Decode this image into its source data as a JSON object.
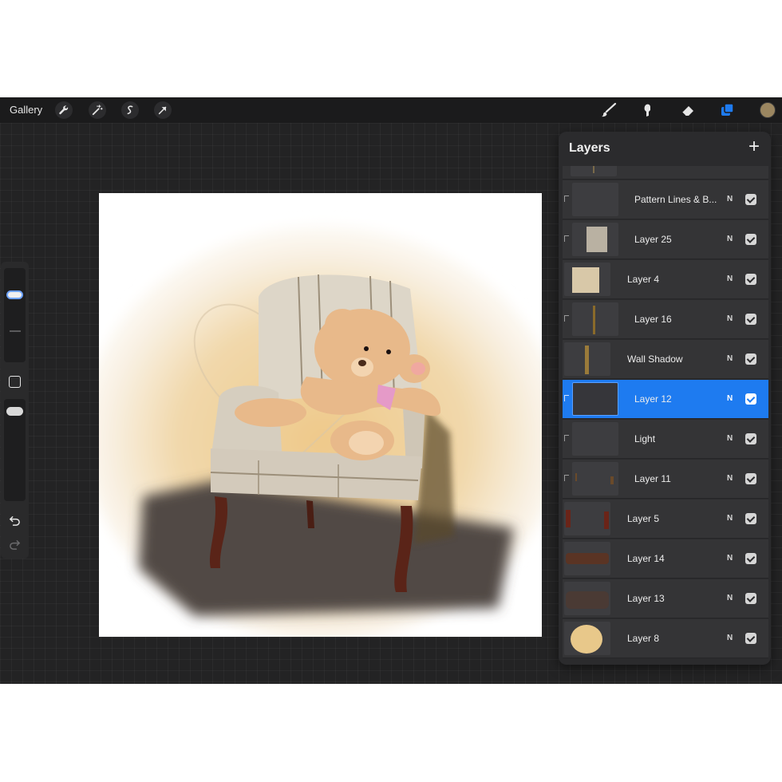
{
  "topbar": {
    "gallery_label": "Gallery",
    "left_tools": [
      {
        "name": "actions-wrench-icon"
      },
      {
        "name": "adjustments-wand-icon"
      },
      {
        "name": "selection-icon"
      },
      {
        "name": "transform-arrow-icon"
      }
    ],
    "right_tools": [
      {
        "name": "brush-icon"
      },
      {
        "name": "smudge-icon"
      },
      {
        "name": "eraser-icon"
      },
      {
        "name": "layers-icon",
        "active_color": "#1e7bf0"
      }
    ],
    "current_color": "#9b8660"
  },
  "sidebar": {
    "brush_size_slider": {
      "level": 0.75
    },
    "opacity_slider": {
      "level": 0.25
    },
    "accent": "#6ea3ff"
  },
  "layers_panel": {
    "title": "Layers",
    "add_label": "+",
    "layers": [
      {
        "name": "",
        "blend": "",
        "visible": true,
        "clipped": false,
        "selected": false
      },
      {
        "name": "Pattern Lines & B...",
        "blend": "N",
        "visible": true,
        "clipped": true,
        "selected": false
      },
      {
        "name": "Layer 25",
        "blend": "N",
        "visible": true,
        "clipped": true,
        "selected": false
      },
      {
        "name": "Layer 4",
        "blend": "N",
        "visible": true,
        "clipped": false,
        "selected": false
      },
      {
        "name": "Layer 16",
        "blend": "N",
        "visible": true,
        "clipped": true,
        "selected": false
      },
      {
        "name": "Wall Shadow",
        "blend": "N",
        "visible": true,
        "clipped": false,
        "selected": false
      },
      {
        "name": "Layer 12",
        "blend": "N",
        "visible": true,
        "clipped": true,
        "selected": true
      },
      {
        "name": "Light",
        "blend": "N",
        "visible": true,
        "clipped": true,
        "selected": false
      },
      {
        "name": "Layer 11",
        "blend": "N",
        "visible": true,
        "clipped": true,
        "selected": false
      },
      {
        "name": "Layer 5",
        "blend": "N",
        "visible": true,
        "clipped": false,
        "selected": false
      },
      {
        "name": "Layer 14",
        "blend": "N",
        "visible": true,
        "clipped": false,
        "selected": false
      },
      {
        "name": "Layer 13",
        "blend": "N",
        "visible": true,
        "clipped": false,
        "selected": false
      },
      {
        "name": "Layer 8",
        "blend": "N",
        "visible": true,
        "clipped": false,
        "selected": false
      }
    ]
  },
  "colors": {
    "selected_layer": "#1e7bf0",
    "panel_bg": "#2b2b2d",
    "app_bg": "#1e1e1f"
  }
}
